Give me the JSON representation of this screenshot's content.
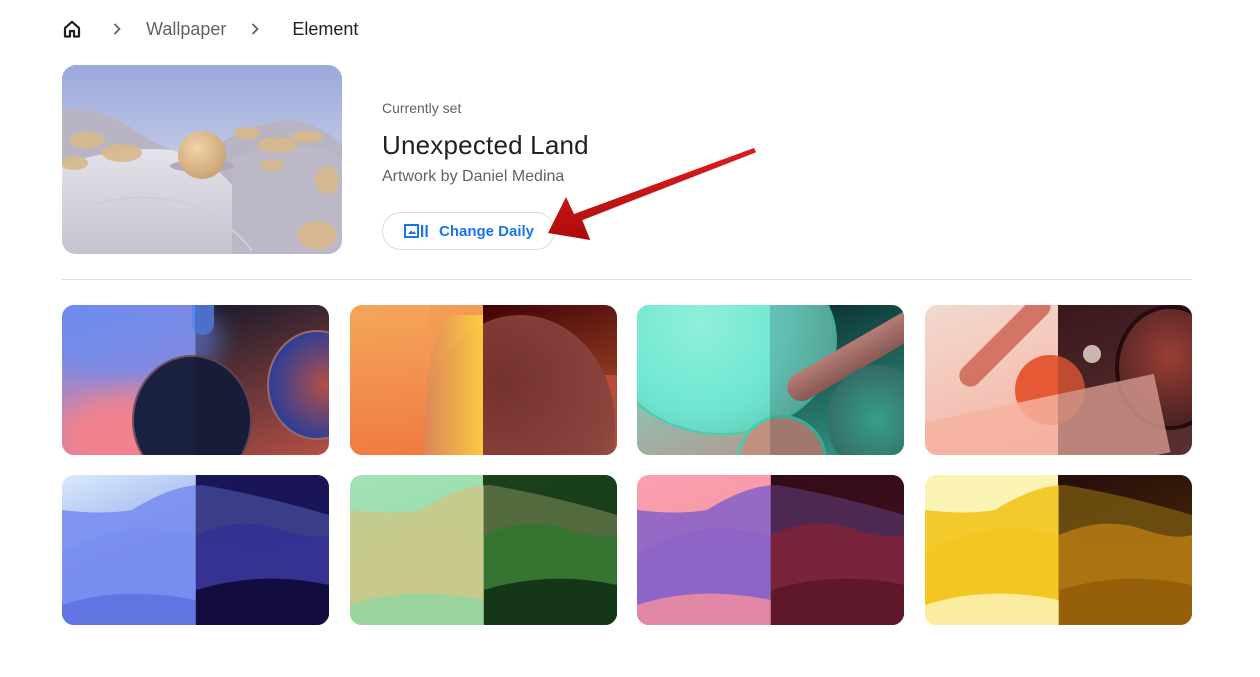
{
  "breadcrumb": {
    "home_icon": "home-icon",
    "separator_icon": "chevron-right-icon",
    "items": [
      {
        "label": "Wallpaper"
      },
      {
        "label": "Element"
      }
    ]
  },
  "current": {
    "label": "Currently set",
    "title": "Unexpected Land",
    "author": "Artwork by Daniel Medina",
    "button": {
      "icon": "change-daily-icon",
      "label": "Change Daily"
    }
  },
  "annotation": {
    "arrow_color": "#cc0000"
  },
  "colors": {
    "accent": "#1a73e8",
    "secondary_text": "#5f6368",
    "primary_text": "#202124",
    "border": "#dadce0"
  },
  "wallpapers": [
    {
      "name": "element-wallpaper-1",
      "light": [
        "#6b8cf0",
        "#d99ad6",
        "#f2828c"
      ],
      "dark": [
        "#171c2e",
        "#1a2040",
        "#d7604e"
      ]
    },
    {
      "name": "element-wallpaper-2",
      "light": [
        "#f5a65a",
        "#f29a80",
        "#f07a40"
      ],
      "dark": [
        "#4a0000",
        "#a65245",
        "#e8703a"
      ]
    },
    {
      "name": "element-wallpaper-3",
      "light": [
        "#6fe6d2",
        "#9be3d2",
        "#b39a90"
      ],
      "dark": [
        "#053030",
        "#d9968a",
        "#3fbfa5"
      ]
    },
    {
      "name": "element-wallpaper-4",
      "light": [
        "#f2d9d0",
        "#cf6a5a",
        "#f6b2a0"
      ],
      "dark": [
        "#421c1c",
        "#b84a3a",
        "#6a3a36"
      ]
    },
    {
      "name": "element-wallpaper-5",
      "light": [
        "#d9eafb",
        "#7a8ef0",
        "#5d6fe0"
      ],
      "dark": [
        "#1d1a6b",
        "#3a36b0",
        "#0e0a3c"
      ]
    },
    {
      "name": "element-wallpaper-6",
      "light": [
        "#a2e3b7",
        "#c9c98a",
        "#8fd4a3"
      ],
      "dark": [
        "#1d4f1d",
        "#2f8f2f",
        "#0f3a14"
      ]
    },
    {
      "name": "element-wallpaper-7",
      "light": [
        "#f9a0ae",
        "#8a64c8",
        "#f7919e"
      ],
      "dark": [
        "#3a0c18",
        "#a0283a",
        "#6a1a2c"
      ]
    },
    {
      "name": "element-wallpaper-8",
      "light": [
        "#faf3b0",
        "#f2c41c",
        "#fdf5c0"
      ],
      "dark": [
        "#2a0f05",
        "#e69a10",
        "#b07008"
      ]
    }
  ]
}
